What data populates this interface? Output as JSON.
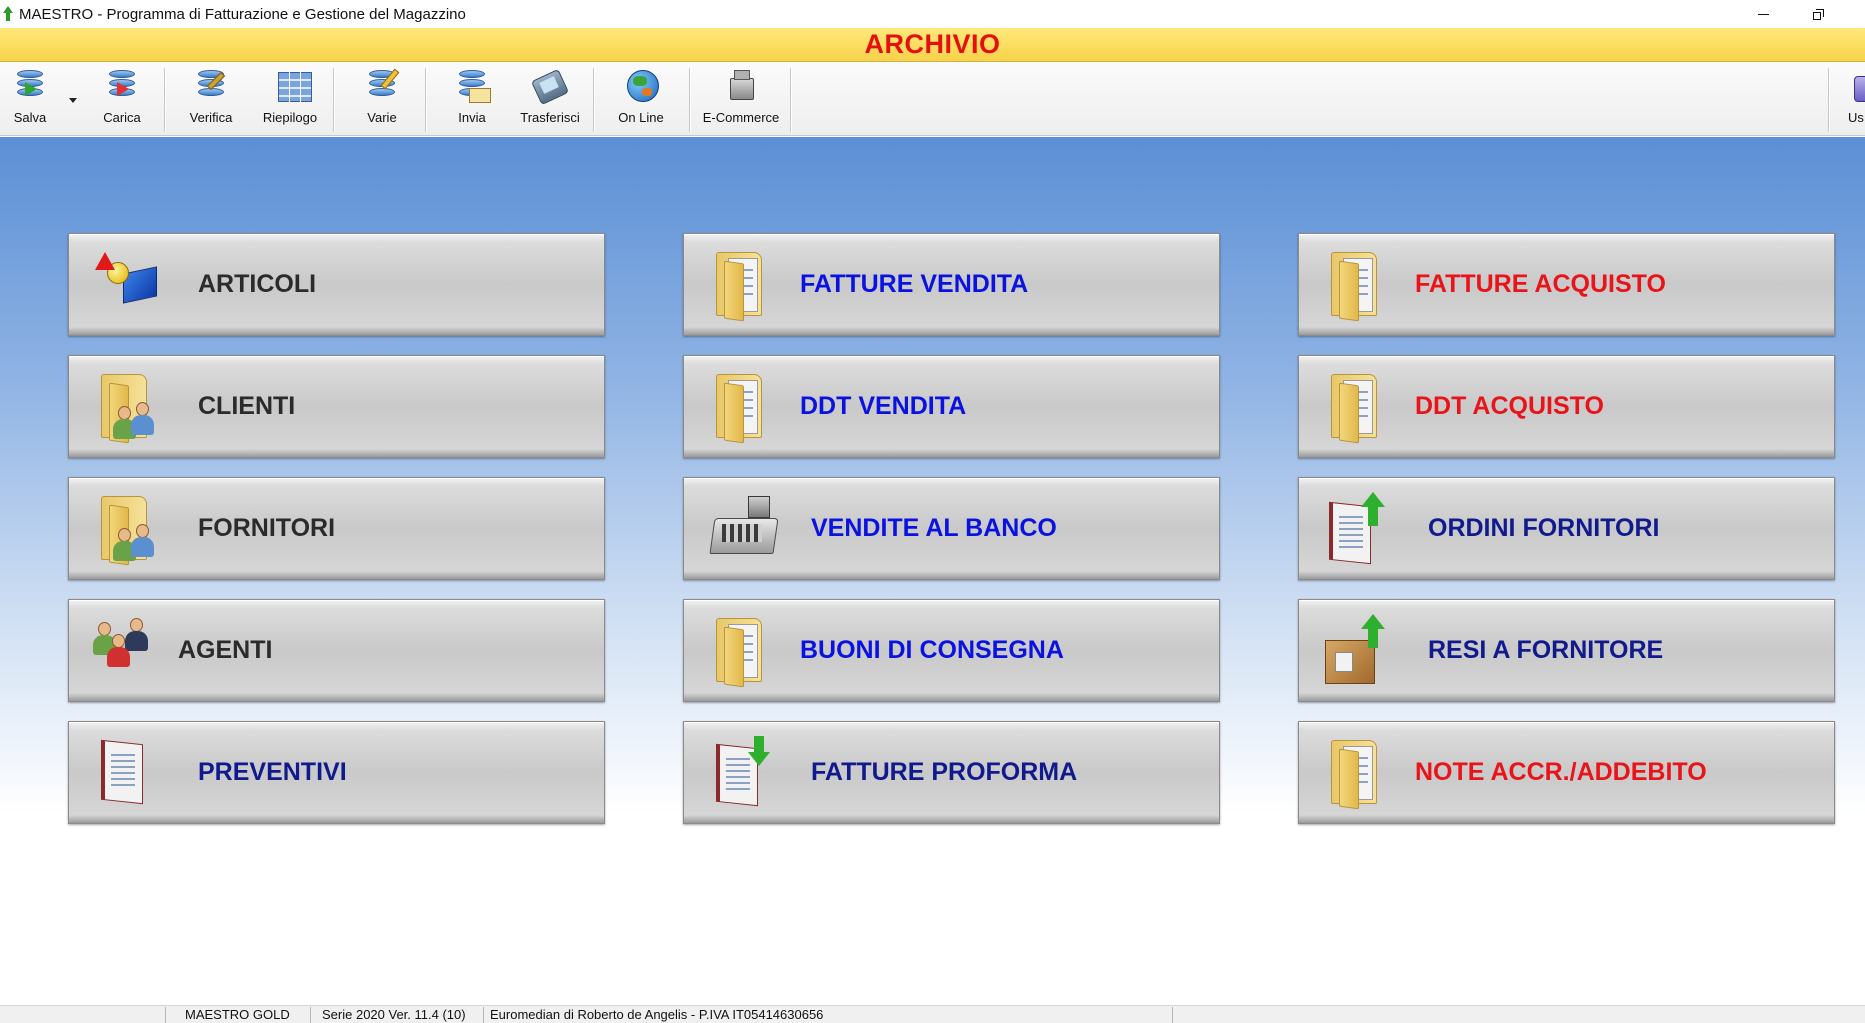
{
  "window": {
    "title": "MAESTRO - Programma di Fatturazione e Gestione del Magazzino"
  },
  "banner": {
    "title": "ARCHIVIO"
  },
  "toolbar": {
    "buttons": [
      {
        "label": "Salva",
        "icon": "save-database-icon"
      },
      {
        "label": "Carica",
        "icon": "load-database-icon"
      },
      {
        "label": "Verifica",
        "icon": "verify-tools-icon"
      },
      {
        "label": "Riepilogo",
        "icon": "summary-table-icon"
      },
      {
        "label": "Varie",
        "icon": "misc-pencil-icon"
      },
      {
        "label": "Invia",
        "icon": "send-mail-icon"
      },
      {
        "label": "Trasferisci",
        "icon": "transfer-device-icon"
      },
      {
        "label": "On Line",
        "icon": "globe-icon"
      },
      {
        "label": "E-Commerce",
        "icon": "e-commerce-icon"
      },
      {
        "label": "Us",
        "icon": "user-icon"
      }
    ]
  },
  "tiles": {
    "col1": [
      {
        "label": "ARTICOLI",
        "icon": "shapes-icon",
        "color": "#2b2b2b"
      },
      {
        "label": "CLIENTI",
        "icon": "folder-people-icon",
        "color": "#2b2b2b"
      },
      {
        "label": "FORNITORI",
        "icon": "folder-people-icon",
        "color": "#2b2b2b"
      },
      {
        "label": "AGENTI",
        "icon": "people-group-icon",
        "color": "#2b2b2b"
      },
      {
        "label": "PREVENTIVI",
        "icon": "document-binder-icon",
        "color": "#101a8c"
      }
    ],
    "col2": [
      {
        "label": "FATTURE VENDITA",
        "icon": "folder-document-icon",
        "color": "#0a12e0"
      },
      {
        "label": "DDT VENDITA",
        "icon": "folder-document-icon",
        "color": "#0a12e0"
      },
      {
        "label": "VENDITE AL BANCO",
        "icon": "cash-register-icon",
        "color": "#0a12e0"
      },
      {
        "label": "BUONI DI CONSEGNA",
        "icon": "folder-document-icon",
        "color": "#0a12e0"
      },
      {
        "label": "FATTURE PROFORMA",
        "icon": "binder-download-icon",
        "color": "#101a8c"
      }
    ],
    "col3": [
      {
        "label": "FATTURE ACQUISTO",
        "icon": "folder-document-icon",
        "color": "#e8141a"
      },
      {
        "label": "DDT ACQUISTO",
        "icon": "folder-document-icon",
        "color": "#e8141a"
      },
      {
        "label": "ORDINI FORNITORI",
        "icon": "binder-upload-icon",
        "color": "#101a8c"
      },
      {
        "label": "RESI A FORNITORE",
        "icon": "box-upload-icon",
        "color": "#101a8c"
      },
      {
        "label": "NOTE ACCR./ADDEBITO",
        "icon": "folder-document-icon",
        "color": "#e8141a"
      }
    ]
  },
  "statusbar": {
    "edition": "MAESTRO GOLD",
    "series": "Serie 2020 Ver. 11.4 (10)",
    "company": "Euromedian di Roberto de Angelis - P.IVA IT05414630656"
  }
}
